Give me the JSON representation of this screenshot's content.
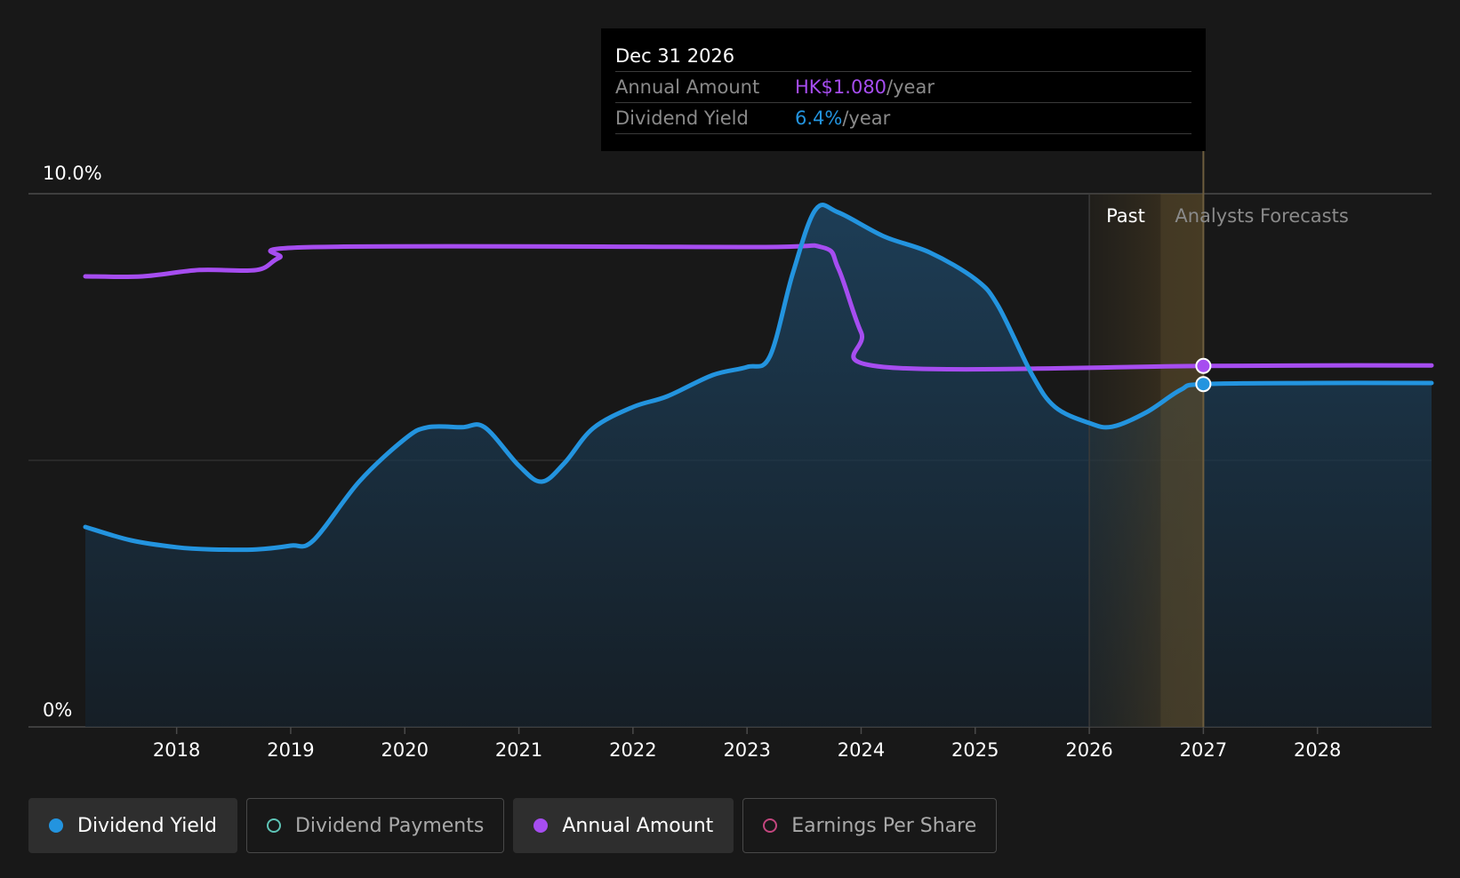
{
  "tooltip": {
    "date": "Dec 31 2026",
    "annual_amount_label": "Annual Amount",
    "annual_amount_value": "HK$1.080",
    "annual_amount_unit": "/year",
    "yield_label": "Dividend Yield",
    "yield_value": "6.4%",
    "yield_unit": "/year"
  },
  "regions": {
    "past_label": "Past",
    "forecast_label": "Analysts Forecasts"
  },
  "legend": [
    {
      "label": "Dividend Yield",
      "color": "#2394df",
      "active": true,
      "marker": "filled"
    },
    {
      "label": "Dividend Payments",
      "color": "#5ec4b6",
      "active": false,
      "marker": "hollow"
    },
    {
      "label": "Annual Amount",
      "color": "#a64df0",
      "active": true,
      "marker": "filled"
    },
    {
      "label": "Earnings Per Share",
      "color": "#c3467e",
      "active": false,
      "marker": "hollow"
    }
  ],
  "colors": {
    "yield": "#2394df",
    "amount": "#a64df0",
    "grid": "#3d3d3d"
  },
  "chart_data": {
    "type": "line",
    "x_ticks": [
      "2018",
      "2019",
      "2020",
      "2021",
      "2022",
      "2023",
      "2024",
      "2025",
      "2026",
      "2027",
      "2028"
    ],
    "x_range": [
      2017.2,
      2029.0
    ],
    "y_ticks": [
      "0%",
      "10.0%"
    ],
    "ylim": [
      0,
      10
    ],
    "forecast_band": [
      2026.0,
      2027.0
    ],
    "tooltip_x": 2027.0,
    "series": [
      {
        "name": "Dividend Yield",
        "unit": "%",
        "points": [
          [
            2017.2,
            3.75
          ],
          [
            2017.6,
            3.5
          ],
          [
            2018.0,
            3.37
          ],
          [
            2018.3,
            3.33
          ],
          [
            2018.7,
            3.33
          ],
          [
            2019.0,
            3.4
          ],
          [
            2019.2,
            3.5
          ],
          [
            2019.6,
            4.6
          ],
          [
            2020.0,
            5.4
          ],
          [
            2020.2,
            5.62
          ],
          [
            2020.5,
            5.62
          ],
          [
            2020.7,
            5.62
          ],
          [
            2021.0,
            4.9
          ],
          [
            2021.2,
            4.6
          ],
          [
            2021.4,
            4.95
          ],
          [
            2021.65,
            5.6
          ],
          [
            2022.0,
            6.0
          ],
          [
            2022.3,
            6.2
          ],
          [
            2022.7,
            6.6
          ],
          [
            2023.0,
            6.75
          ],
          [
            2023.2,
            6.95
          ],
          [
            2023.4,
            8.5
          ],
          [
            2023.6,
            9.7
          ],
          [
            2023.8,
            9.65
          ],
          [
            2024.2,
            9.2
          ],
          [
            2024.6,
            8.9
          ],
          [
            2025.0,
            8.4
          ],
          [
            2025.2,
            7.9
          ],
          [
            2025.5,
            6.6
          ],
          [
            2025.7,
            6.0
          ],
          [
            2026.0,
            5.7
          ],
          [
            2026.2,
            5.63
          ],
          [
            2026.5,
            5.9
          ],
          [
            2026.8,
            6.32
          ],
          [
            2027.0,
            6.43
          ],
          [
            2028.0,
            6.45
          ],
          [
            2029.0,
            6.45
          ]
        ]
      },
      {
        "name": "Annual Amount",
        "unit": "HK$",
        "points": [
          [
            2017.2,
            8.45
          ],
          [
            2017.7,
            8.45
          ],
          [
            2018.2,
            8.57
          ],
          [
            2018.7,
            8.57
          ],
          [
            2018.9,
            8.8
          ],
          [
            2019.2,
            9.0
          ],
          [
            2023.0,
            9.0
          ],
          [
            2023.65,
            9.0
          ],
          [
            2023.8,
            8.6
          ],
          [
            2024.0,
            7.4
          ],
          [
            2024.2,
            6.75
          ],
          [
            2027.0,
            6.77
          ],
          [
            2028.0,
            6.78
          ],
          [
            2029.0,
            6.78
          ]
        ]
      }
    ]
  }
}
